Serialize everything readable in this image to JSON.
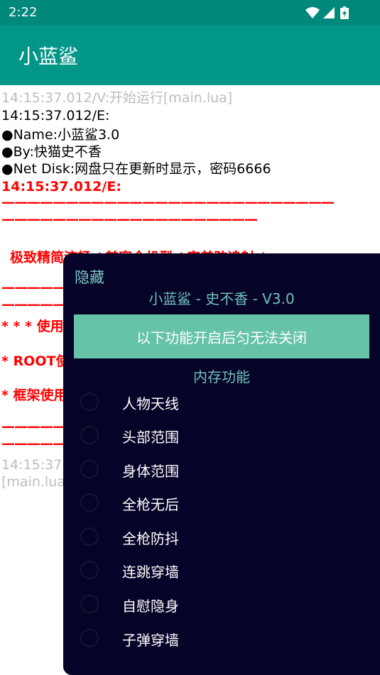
{
  "status_bar": {
    "time": "2:22",
    "icons": [
      "wifi-icon",
      "cell-signal-icon",
      "battery-charging-icon"
    ]
  },
  "app": {
    "title": "小蓝鲨",
    "colors": {
      "appbar": "#009688",
      "statusbar": "#00897b"
    }
  },
  "log": {
    "lines": [
      "14:15:37.012/V:开始运行[main.lua]",
      "14:15:37.012/E:",
      "●Name:小蓝鲨3.0",
      "●By:快猫史不香",
      "●Net Disk:网盘只在更新时显示，密码6666",
      "14:15:37.012/E:",
      "——————————————————————————",
      "————————————————————",
      "极致精简流畅 / 兼容全机型 / 完美防追封 /",
      "——————",
      "——————",
      "* * * 使用说",
      "* ROOT使",
      "* 框架使用",
      "——————",
      "——————",
      "14:15:37.",
      "[main.lua]"
    ]
  },
  "panel": {
    "hide_label": "隐藏",
    "title": "小蓝鲨 - 史不香 - V3.0",
    "notice": "以下功能开启后匀无法关闭",
    "section": "内存功能",
    "colors": {
      "background": "#050327",
      "accent": "#66c2a9",
      "title_text": "#6fc2bb"
    },
    "options": [
      {
        "label": "人物天线",
        "checked": false
      },
      {
        "label": "头部范围",
        "checked": false
      },
      {
        "label": "身体范围",
        "checked": false
      },
      {
        "label": "全枪无后",
        "checked": false
      },
      {
        "label": "全枪防抖",
        "checked": false
      },
      {
        "label": "连跳穿墙",
        "checked": false
      },
      {
        "label": "自慰隐身",
        "checked": false
      },
      {
        "label": "子弹穿墙",
        "checked": false
      }
    ]
  }
}
